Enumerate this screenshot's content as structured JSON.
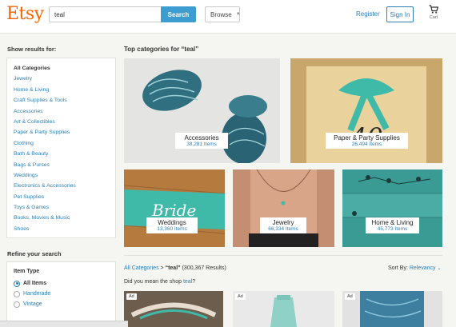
{
  "header": {
    "logo": "Etsy",
    "search_value": "teal",
    "search_button": "Search",
    "browse_label": "Browse",
    "register_label": "Register",
    "signin_label": "Sign In",
    "cart_label": "Cart"
  },
  "sidebar": {
    "show_results_label": "Show results for:",
    "categories": [
      "All Categories",
      "Jewelry",
      "Home & Living",
      "Craft Supplies & Tools",
      "Accessories",
      "Art & Collectibles",
      "Paper & Party Supplies",
      "Clothing",
      "Bath & Beauty",
      "Bags & Purses",
      "Weddings",
      "Electronics & Accessories",
      "Pet Supplies",
      "Toys & Games",
      "Books, Movies & Music",
      "Shoes"
    ],
    "refine_label": "Refine your search",
    "item_type": {
      "title": "Item Type",
      "options": [
        "All Items",
        "Handmade",
        "Vintage"
      ],
      "selected": "All Items"
    }
  },
  "main": {
    "top_categories_title": "Top categories for “teal”",
    "tiles": [
      {
        "name": "Accessories",
        "count": "38,281 Items"
      },
      {
        "name": "Paper & Party Supplies",
        "count": "26,494 Items"
      },
      {
        "name": "Weddings",
        "count": "13,360 Items"
      },
      {
        "name": "Jewelry",
        "count": "66,334 Items"
      },
      {
        "name": "Home & Living",
        "count": "45,773 Items"
      }
    ],
    "breadcrumb": {
      "link": "All Categories",
      "separator": ">",
      "query": "“teal”",
      "results": "(300,367 Results)"
    },
    "sort": {
      "label": "Sort By:",
      "value": "Relevancy"
    },
    "did_you_mean": {
      "prefix": "Did you mean the shop",
      "shop": "teal",
      "suffix": "?"
    },
    "listings": [
      {
        "badge": "Ad"
      },
      {
        "badge": "Ad"
      },
      {
        "badge": "Ad"
      }
    ],
    "tile_art_text": {
      "paper": "40",
      "wedding": "Bride"
    }
  },
  "colors": {
    "brand": "#f56400",
    "link": "#2c7fb8",
    "search_button": "#3d9dd1",
    "teal": "#3fb9a8"
  }
}
